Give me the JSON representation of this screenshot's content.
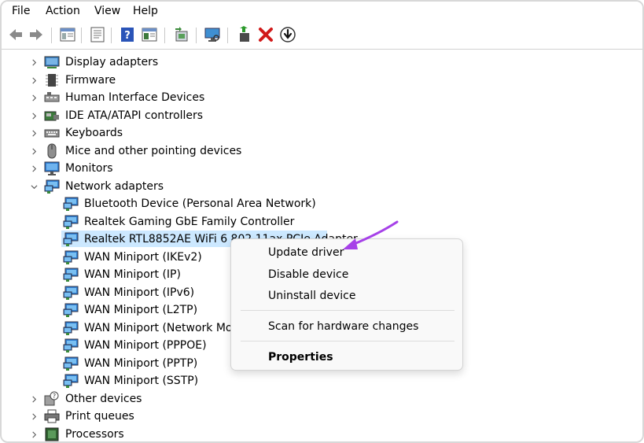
{
  "menubar": {
    "items": [
      "File",
      "Action",
      "View",
      "Help"
    ]
  },
  "toolbar": {
    "buttons": [
      "back-arrow-icon",
      "forward-arrow-icon",
      "console-tree-icon",
      "properties-icon",
      "help-icon",
      "show-hide-icon",
      "update-driver-icon",
      "scan-hardware-icon",
      "enable-device-icon",
      "uninstall-x-icon",
      "disable-down-arrow-icon"
    ],
    "accent_red": "#d11a1a",
    "accent_blue": "#2a6fd6"
  },
  "tree": {
    "categories_top": [
      {
        "label": "Display adapters",
        "icon": "display-adapter-icon",
        "expanded": false
      },
      {
        "label": "Firmware",
        "icon": "firmware-chip-icon",
        "expanded": false
      },
      {
        "label": "Human Interface Devices",
        "icon": "hid-keyboard-icon",
        "expanded": false
      },
      {
        "label": "IDE ATA/ATAPI controllers",
        "icon": "ide-controller-icon",
        "expanded": false
      },
      {
        "label": "Keyboards",
        "icon": "keyboard-icon",
        "expanded": false
      },
      {
        "label": "Mice and other pointing devices",
        "icon": "mouse-icon",
        "expanded": false
      },
      {
        "label": "Monitors",
        "icon": "monitor-icon",
        "expanded": false
      },
      {
        "label": "Network adapters",
        "icon": "network-adapter-icon",
        "expanded": true
      }
    ],
    "network_children": [
      "Bluetooth Device (Personal Area Network)",
      "Realtek Gaming GbE Family Controller",
      "Realtek RTL8852AE WiFi 6 802.11ax PCIe Adapter",
      "WAN Miniport (IKEv2)",
      "WAN Miniport (IP)",
      "WAN Miniport (IPv6)",
      "WAN Miniport (L2TP)",
      "WAN Miniport (Network Monitor)",
      "WAN Miniport (PPPOE)",
      "WAN Miniport (PPTP)",
      "WAN Miniport (SSTP)"
    ],
    "selected_child_index": 2,
    "categories_bottom": [
      {
        "label": "Other devices",
        "icon": "unknown-device-icon",
        "expanded": false
      },
      {
        "label": "Print queues",
        "icon": "printer-icon",
        "expanded": false
      },
      {
        "label": "Processors",
        "icon": "processor-icon",
        "expanded": false
      }
    ],
    "selection_color": "#cce8ff"
  },
  "context_menu": {
    "items": [
      "Update driver",
      "Disable device",
      "Uninstall device"
    ],
    "scan": "Scan for hardware changes",
    "properties": "Properties"
  },
  "annotation": {
    "arrow_color": "#a641e8"
  }
}
